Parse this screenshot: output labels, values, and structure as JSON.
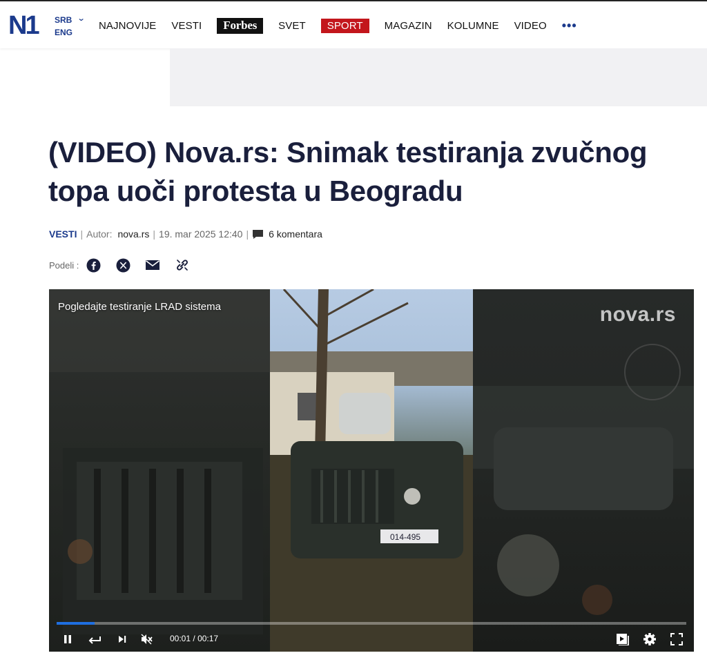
{
  "header": {
    "logo": "N1",
    "lang_primary": "SRB",
    "lang_secondary": "ENG",
    "nav": [
      "NAJNOVIJE",
      "VESTI",
      "Forbes",
      "SVET",
      "SPORT",
      "MAGAZIN",
      "KOLUMNE",
      "VIDEO"
    ],
    "more": "•••"
  },
  "article": {
    "title": "(VIDEO) Nova.rs: Snimak testiranja zvučnog topa uoči protesta u Beogradu",
    "category": "VESTI",
    "author_label": "Autor:",
    "author": "nova.rs",
    "date": "19. mar 2025 12:40",
    "comments": "6 komentara",
    "share_label": "Podeli :"
  },
  "video": {
    "caption": "Pogledajte testiranje LRAD sistema",
    "watermark": "nova.rs",
    "current_time": "00:01",
    "duration": "00:17",
    "time_sep": "/",
    "progress_fraction": 0.06,
    "plate": "014-495"
  },
  "colors": {
    "brand": "#1b3a8c",
    "sport": "#c3161c",
    "progress": "#1f6fe0"
  }
}
